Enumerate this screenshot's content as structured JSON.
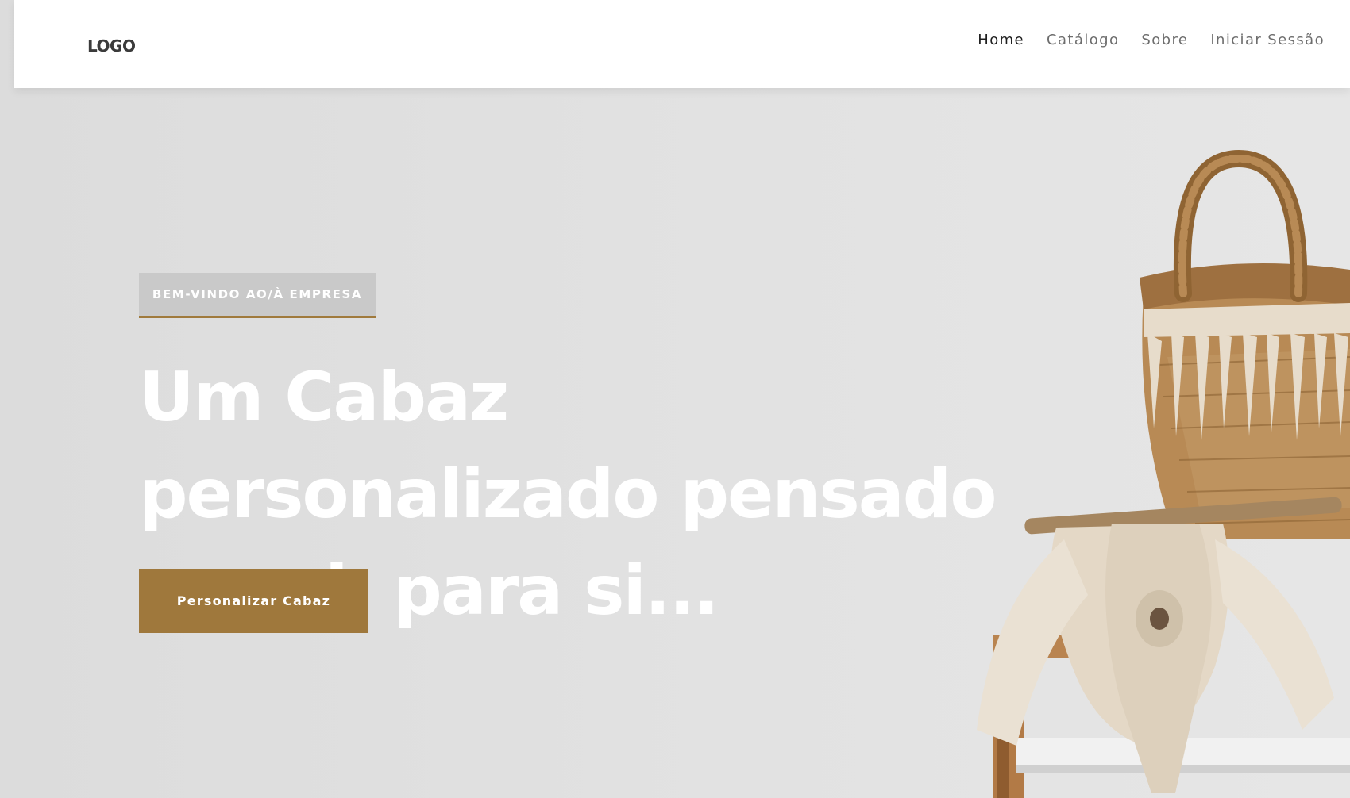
{
  "header": {
    "logo_text": "LOGO",
    "nav": [
      {
        "label": "Home",
        "active": true
      },
      {
        "label": "Catálogo",
        "active": false
      },
      {
        "label": "Sobre",
        "active": false
      },
      {
        "label": "Iniciar Sessão",
        "active": false
      }
    ]
  },
  "hero": {
    "badge": "BEM-VINDO AO/À EMPRESA",
    "headline": "Um Cabaz personalizado pensado por si, para si...",
    "cta_label": "Personalizar Cabaz"
  },
  "image": {
    "subject": "woven-basket-with-macrame-on-wooden-stool"
  },
  "colors": {
    "accent": "#9f783c",
    "badge_bg": "#c9c9c9",
    "hero_bg": "#e0e0e0",
    "header_bg": "#ffffff"
  }
}
